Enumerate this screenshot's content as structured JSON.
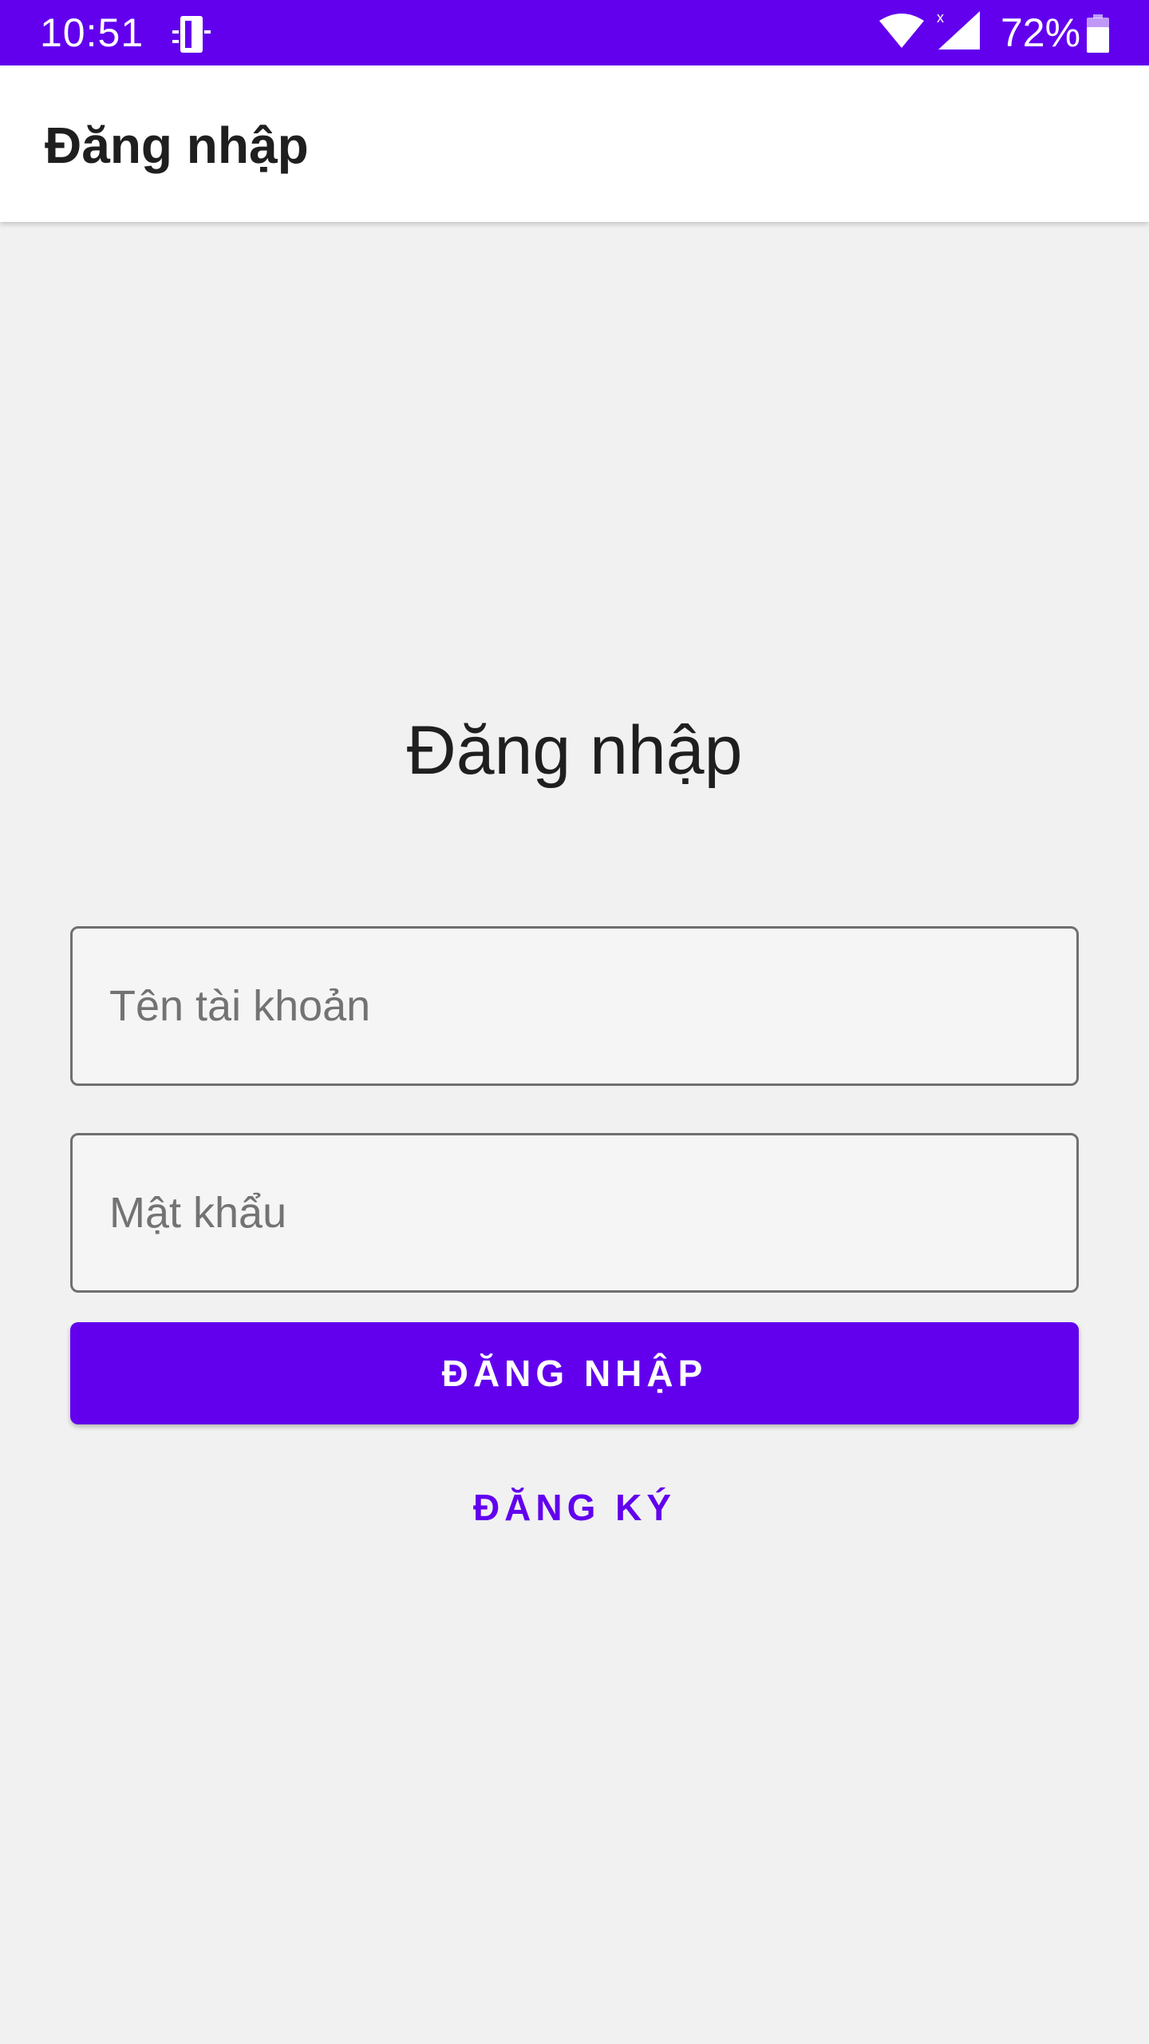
{
  "status_bar": {
    "time": "10:51",
    "notification_icon": "device-notification-icon",
    "wifi_icon": "wifi-icon",
    "signal_icon": "cell-signal-icon",
    "battery_percent": "72%",
    "battery_icon": "battery-icon",
    "color": "#6200ee"
  },
  "app_bar": {
    "title": "Đăng nhập"
  },
  "main": {
    "heading": "Đăng nhập",
    "username_placeholder": "Tên tài khoản",
    "username_value": "",
    "password_placeholder": "Mật khẩu",
    "password_value": "",
    "login_button_label": "ĐĂNG NHẬP",
    "register_button_label": "ĐĂNG KÝ"
  },
  "colors": {
    "accent": "#6200ee",
    "background": "#f1f1f1"
  }
}
